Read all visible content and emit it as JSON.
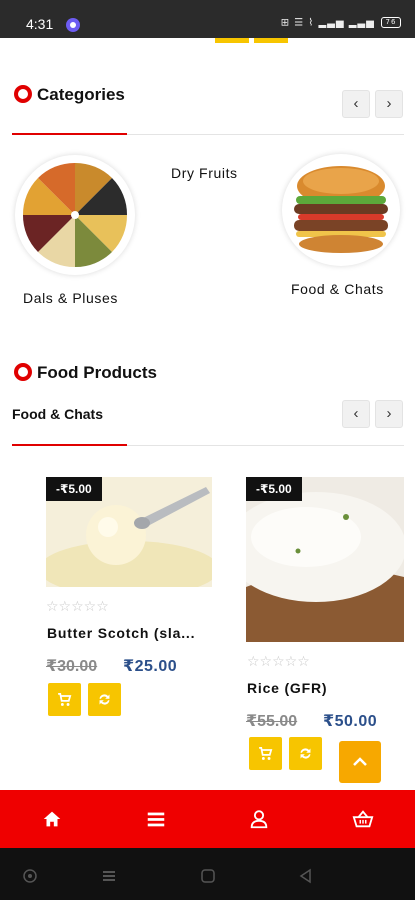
{
  "status_bar": {
    "time": "4:31",
    "system_icons": "⊞ ☰ ⌇ ▂▃▅ ▂▃▅",
    "battery": "76"
  },
  "categories": {
    "title": "Categories",
    "prev_icon": "chevron-left-icon",
    "next_icon": "chevron-right-icon",
    "items": [
      {
        "label": "Dals & Pluses"
      },
      {
        "label": "Dry Fruits"
      },
      {
        "label": "Food & Chats"
      }
    ]
  },
  "food_products": {
    "title": "Food Products",
    "active_tab": "Food & Chats",
    "products": [
      {
        "badge": "-₹5.00",
        "name": "Butter Scotch (sla...",
        "old_price": "₹30.00",
        "price": "₹25.00",
        "rating": 0
      },
      {
        "badge": "-₹5.00",
        "name": "Rice (GFR)",
        "old_price": "₹55.00",
        "price": "₹50.00",
        "rating": 0
      }
    ]
  },
  "bottom_nav": {
    "items": [
      "home-icon",
      "menu-icon",
      "account-icon",
      "basket-icon"
    ]
  },
  "colors": {
    "accent_red": "#ef0000",
    "accent_yellow": "#f7c500",
    "price_blue": "#2b4f8a"
  }
}
